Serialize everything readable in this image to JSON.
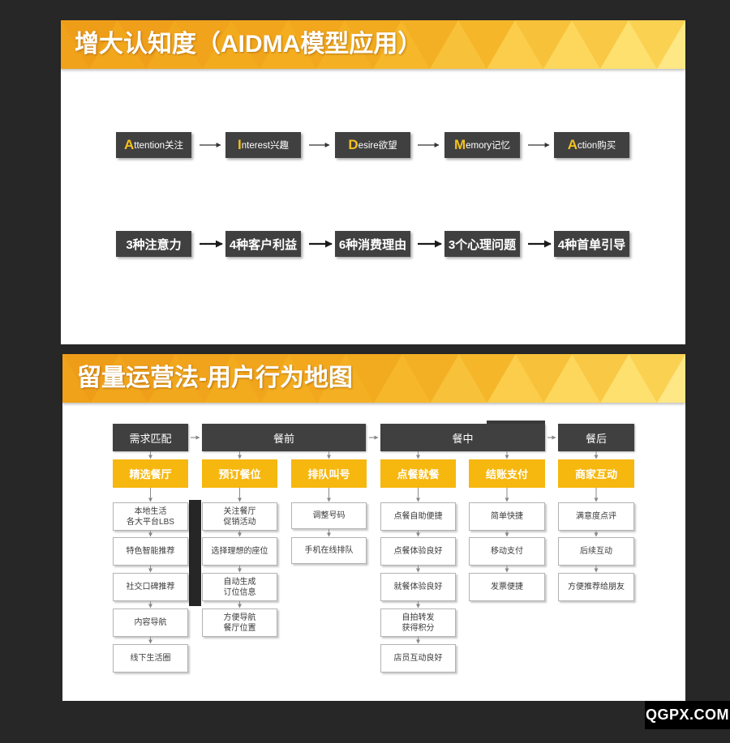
{
  "aidma_slide": {
    "title": "增大认知度（AIDMA模型应用）",
    "stages": [
      {
        "initial": "A",
        "rest": "ttention关注"
      },
      {
        "initial": "I",
        "rest": "nterest兴趣"
      },
      {
        "initial": "D",
        "rest": "esire欲望"
      },
      {
        "initial": "M",
        "rest": "emory记忆"
      },
      {
        "initial": "A",
        "rest": "ction购买"
      }
    ],
    "tactics": [
      "3种注意力",
      "4种客户利益",
      "6种消费理由",
      "3个心理问题",
      "4种首单引导"
    ]
  },
  "journey_slide": {
    "title": "留量运营法-用户行为地图",
    "phases": [
      "需求匹配",
      "餐前",
      "餐中",
      "餐后"
    ],
    "steps": [
      {
        "label": "精选餐厅",
        "details": [
          "本地生活\n各大平台LBS",
          "特色智能推荐",
          "社交口碑推荐",
          "内容导航",
          "线下生活圈"
        ]
      },
      {
        "label": "预订餐位",
        "details": [
          "关注餐厅\n促销活动",
          "选择理想的座位",
          "自动生成\n订位信息",
          "方便导航\n餐厅位置"
        ]
      },
      {
        "label": "排队叫号",
        "details": [
          "调整号码",
          "手机在线排队"
        ]
      },
      {
        "label": "点餐就餐",
        "details": [
          "点餐自助便捷",
          "点餐体验良好",
          "就餐体验良好",
          "自拍转发\n获得积分",
          "店员互动良好"
        ]
      },
      {
        "label": "结账支付",
        "details": [
          "简单快捷",
          "移动支付",
          "发票便捷"
        ]
      },
      {
        "label": "商家互动",
        "details": [
          "满意度点评",
          "后续互动",
          "方便推荐给朋友"
        ]
      }
    ]
  },
  "watermark": "QGPX.COM",
  "colors": {
    "page_background": "#272727",
    "box_dark": "#404040",
    "accent": "#f6b70f",
    "initial_letter": "#f4c21c",
    "header_orange": "#ef9f1a",
    "header_yellow": "#fee785"
  }
}
